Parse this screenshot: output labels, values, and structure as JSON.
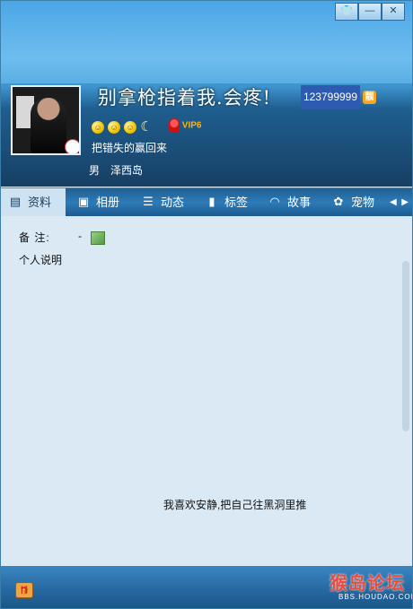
{
  "window": {
    "controls": {
      "skin": "👕",
      "minimize": "—",
      "close": "✕"
    }
  },
  "profile": {
    "nickname": "别拿枪指着我.会疼!",
    "qq_number": "123799999",
    "pretty_badge": "靓",
    "level_icons": [
      "sun-icon",
      "sun-icon",
      "sun-icon",
      "moon-icon"
    ],
    "vip_label": "VIP6",
    "signature": "把错失的赢回来",
    "gender": "男",
    "location": "泽西岛"
  },
  "tabs": [
    {
      "label": "资料",
      "icon": "profile-card-icon",
      "active": true
    },
    {
      "label": "相册",
      "icon": "photo-album-icon"
    },
    {
      "label": "动态",
      "icon": "feed-list-icon"
    },
    {
      "label": "标签",
      "icon": "bookmark-tag-icon"
    },
    {
      "label": "故事",
      "icon": "story-rainbow-icon"
    },
    {
      "label": "宠物",
      "icon": "pet-paw-icon"
    }
  ],
  "content": {
    "remark_label": "备    注:",
    "remark_value": "-",
    "description_label": "个人说明",
    "description_text": "我喜欢安静,把自己往黑洞里推"
  },
  "footer": {
    "watermark": "猴岛论坛",
    "watermark_sub": "BBS.HOUDAO.COM"
  }
}
